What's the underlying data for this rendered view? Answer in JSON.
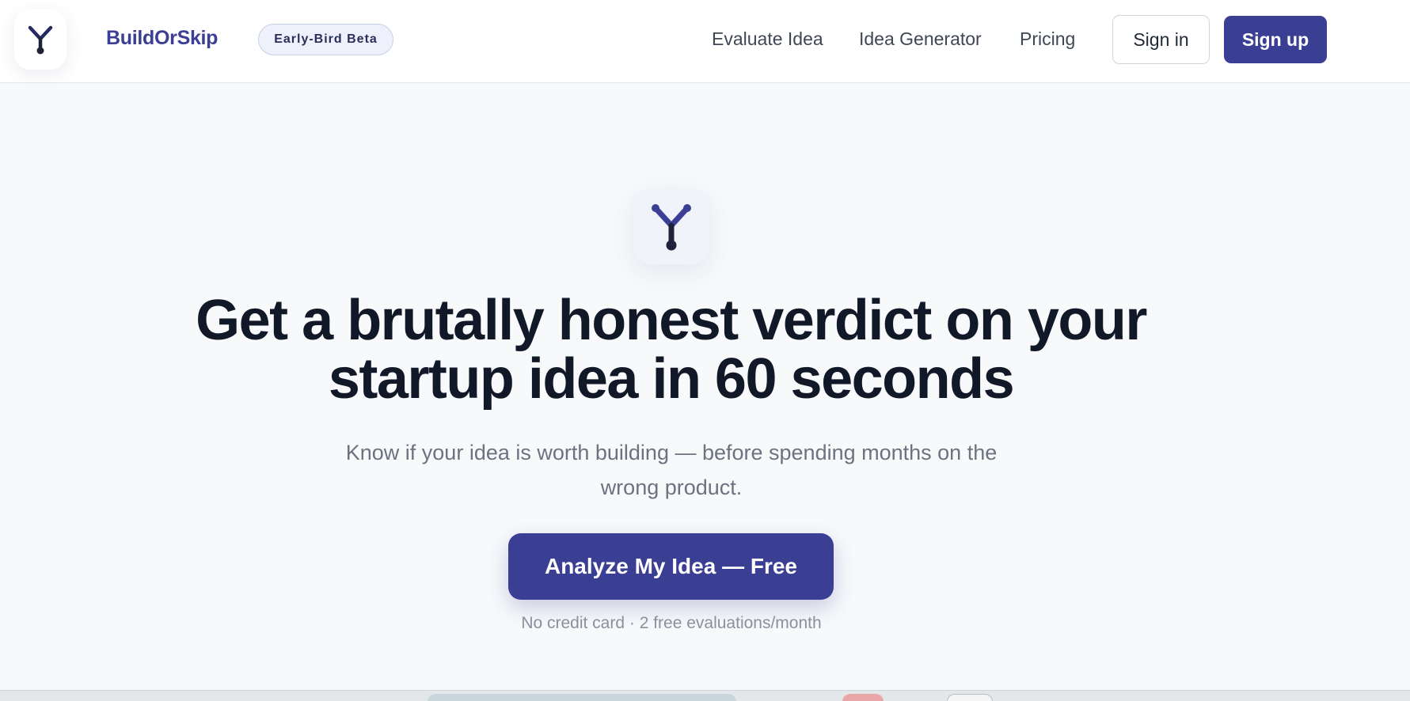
{
  "brand": {
    "name": "BuildOrSkip",
    "badge": "Early-Bird Beta",
    "logo_icon": "y-fork-logo-icon",
    "accent_color": "#3b3f94"
  },
  "nav": {
    "links": [
      "Evaluate Idea",
      "Idea Generator",
      "Pricing"
    ],
    "sign_in": "Sign in",
    "sign_up": "Sign up"
  },
  "hero": {
    "headline": "Get a brutally honest verdict on your startup idea in 60 seconds",
    "subheadline": "Know if your idea is worth building — before spending months on the wrong product.",
    "cta": "Analyze My Idea — Free",
    "note": "No credit card · 2 free evaluations/month"
  }
}
